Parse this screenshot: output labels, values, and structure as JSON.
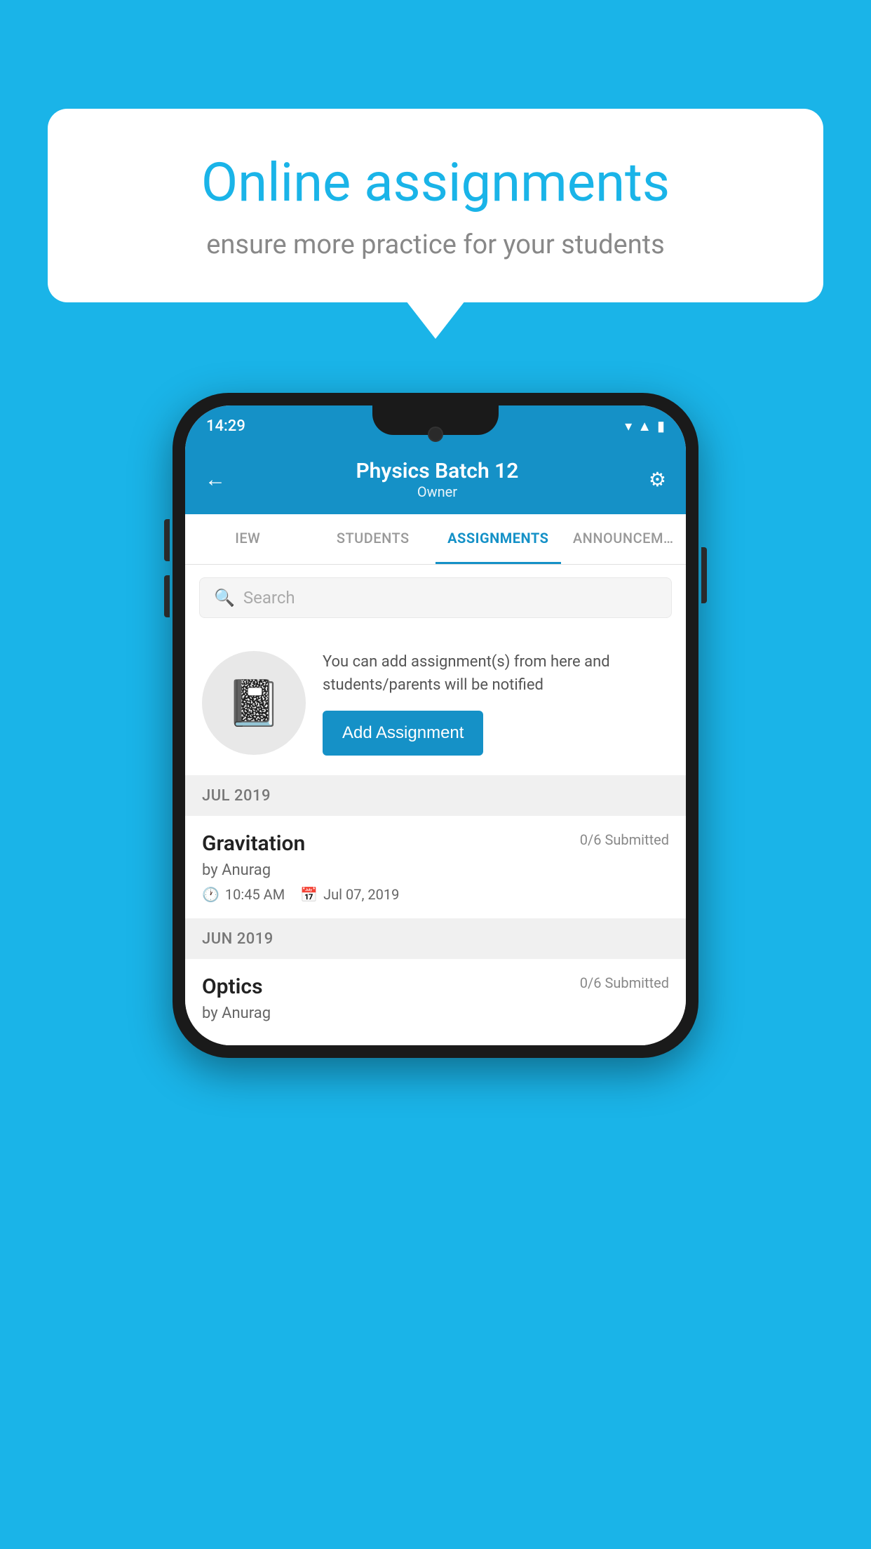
{
  "background": {
    "color": "#1ab4e8"
  },
  "speech_bubble": {
    "title": "Online assignments",
    "subtitle": "ensure more practice for your students"
  },
  "phone": {
    "status_bar": {
      "time": "14:29",
      "icons": [
        "wifi",
        "signal",
        "battery"
      ]
    },
    "header": {
      "title": "Physics Batch 12",
      "subtitle": "Owner",
      "back_label": "←",
      "settings_label": "⚙"
    },
    "tabs": [
      {
        "label": "IEW",
        "active": false
      },
      {
        "label": "STUDENTS",
        "active": false
      },
      {
        "label": "ASSIGNMENTS",
        "active": true
      },
      {
        "label": "ANNOUNCEM…",
        "active": false
      }
    ],
    "search": {
      "placeholder": "Search"
    },
    "promo": {
      "text": "You can add assignment(s) from here and students/parents will be notified",
      "button_label": "Add Assignment"
    },
    "sections": [
      {
        "month": "JUL 2019",
        "assignments": [
          {
            "name": "Gravitation",
            "submitted": "0/6 Submitted",
            "by": "by Anurag",
            "time": "10:45 AM",
            "date": "Jul 07, 2019"
          }
        ]
      },
      {
        "month": "JUN 2019",
        "assignments": [
          {
            "name": "Optics",
            "submitted": "0/6 Submitted",
            "by": "by Anurag",
            "time": "",
            "date": ""
          }
        ]
      }
    ]
  }
}
